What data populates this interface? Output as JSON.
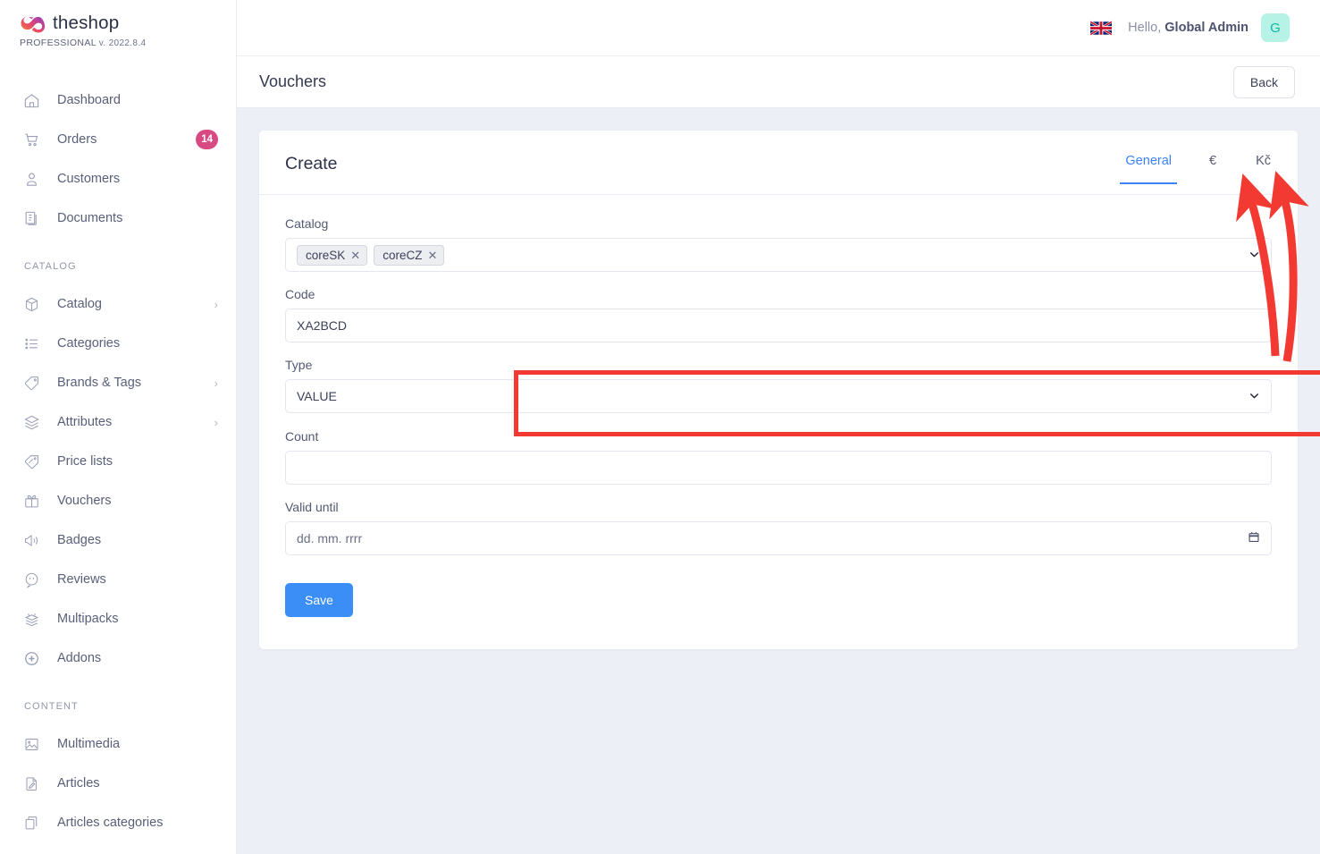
{
  "brand": {
    "name": "theshop",
    "edition": "PROFESSIONAL",
    "version": "v. 2022.8.4",
    "logo_icon": "infinity-logo-icon",
    "gradient_from": "#f6842a",
    "gradient_to": "#8c3ec0"
  },
  "sidebar": {
    "items": [
      {
        "label": "Dashboard",
        "icon": "home-icon",
        "badge": null,
        "chevron": false
      },
      {
        "label": "Orders",
        "icon": "cart-icon",
        "badge": "14",
        "chevron": false
      },
      {
        "label": "Customers",
        "icon": "user-icon",
        "badge": null,
        "chevron": false
      },
      {
        "label": "Documents",
        "icon": "documents-icon",
        "badge": null,
        "chevron": false
      }
    ],
    "groups": [
      {
        "label": "CATALOG",
        "items": [
          {
            "label": "Catalog",
            "icon": "box-icon",
            "chevron": true
          },
          {
            "label": "Categories",
            "icon": "list-icon",
            "chevron": false
          },
          {
            "label": "Brands & Tags",
            "icon": "tag-icon",
            "chevron": true
          },
          {
            "label": "Attributes",
            "icon": "layers-icon",
            "chevron": true
          },
          {
            "label": "Price lists",
            "icon": "price-tag-icon",
            "chevron": false
          },
          {
            "label": "Vouchers",
            "icon": "gift-icon",
            "chevron": false
          },
          {
            "label": "Badges",
            "icon": "megaphone-icon",
            "chevron": false
          },
          {
            "label": "Reviews",
            "icon": "comment-icon",
            "chevron": false
          },
          {
            "label": "Multipacks",
            "icon": "multipack-icon",
            "chevron": false
          },
          {
            "label": "Addons",
            "icon": "plus-circle-icon",
            "chevron": false
          }
        ]
      },
      {
        "label": "CONTENT",
        "items": [
          {
            "label": "Multimedia",
            "icon": "image-icon",
            "chevron": false
          },
          {
            "label": "Articles",
            "icon": "article-icon",
            "chevron": false
          },
          {
            "label": "Articles categories",
            "icon": "copy-icon",
            "chevron": false
          }
        ]
      }
    ],
    "badge_color": "#d74b82"
  },
  "topbar": {
    "flag_icon": "uk-flag-icon",
    "greeting_prefix": "Hello,",
    "user_name": "Global Admin",
    "avatar_initial": "G",
    "avatar_bg": "#b6f2e6",
    "avatar_color": "#11b8a4"
  },
  "pagebar": {
    "title": "Vouchers",
    "back_label": "Back"
  },
  "card": {
    "title": "Create",
    "tabs": [
      {
        "label": "General",
        "active": true,
        "name": "tab-general"
      },
      {
        "label": "€",
        "active": false,
        "name": "tab-currency-eur"
      },
      {
        "label": "Kč",
        "active": false,
        "name": "tab-currency-czk"
      }
    ],
    "active_tab_color": "#3b82f6"
  },
  "form": {
    "catalog": {
      "label": "Catalog",
      "tags": [
        "coreSK",
        "coreCZ"
      ],
      "remove_icon": "close-icon",
      "chevron_icon": "chevron-down-icon"
    },
    "code": {
      "label": "Code",
      "value": "XA2BCD",
      "placeholder": ""
    },
    "type": {
      "label": "Type",
      "value": "VALUE",
      "chevron_icon": "chevron-down-icon"
    },
    "count": {
      "label": "Count",
      "value": "",
      "placeholder": ""
    },
    "valid_until": {
      "label": "Valid until",
      "value": "",
      "placeholder": "dd. mm. rrrr",
      "calendar_icon": "calendar-icon"
    },
    "save_label": "Save",
    "save_color": "#3b8ef5"
  },
  "annotations": {
    "highlight_color": "#f23a32",
    "boxes": [
      "currency-tabs",
      "type-field"
    ],
    "arrows": 2
  }
}
